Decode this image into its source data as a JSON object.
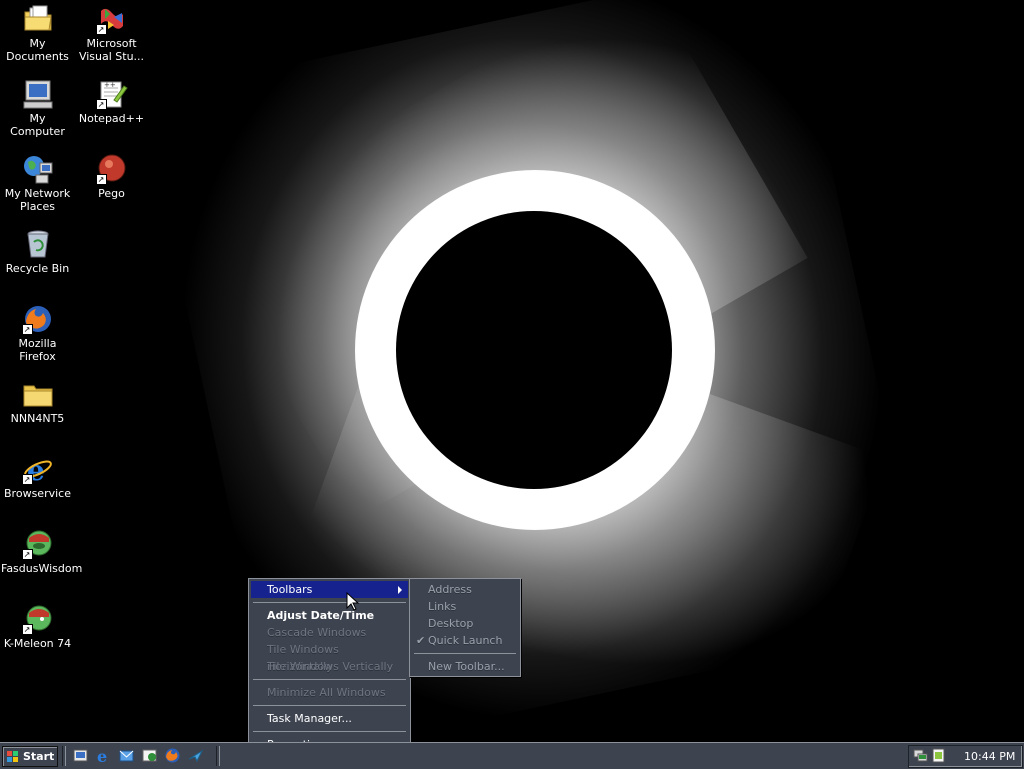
{
  "desktop": {
    "icons": [
      {
        "label": "My Documents",
        "icon": "folder-documents-icon"
      },
      {
        "label": "Microsoft Visual Stu...",
        "icon": "visual-studio-icon"
      },
      {
        "label": "My Computer",
        "icon": "computer-icon"
      },
      {
        "label": "Notepad++",
        "icon": "notepad-plus-plus-icon"
      },
      {
        "label": "My Network Places",
        "icon": "network-places-icon"
      },
      {
        "label": "Pego",
        "icon": "pego-icon"
      },
      {
        "label": "Recycle Bin",
        "icon": "recycle-bin-icon"
      },
      {
        "label": "Mozilla Firefox",
        "icon": "firefox-icon"
      },
      {
        "label": "NNN4NT5",
        "icon": "folder-icon"
      },
      {
        "label": "Browservice",
        "icon": "internet-explorer-icon"
      },
      {
        "label": "FasdusWisdom",
        "icon": "fasdus-wisdom-icon"
      },
      {
        "label": "K-Meleon 74",
        "icon": "k-meleon-icon"
      }
    ]
  },
  "context_menu": {
    "items": [
      {
        "label": "Toolbars",
        "state": "highlighted",
        "has_submenu": true
      },
      {
        "label": "Adjust Date/Time",
        "state": "bold"
      },
      {
        "label": "Cascade Windows",
        "state": "disabled"
      },
      {
        "label": "Tile Windows Horizontally",
        "state": "disabled"
      },
      {
        "label": "Tile Windows Vertically",
        "state": "disabled"
      },
      {
        "label": "Minimize All Windows",
        "state": "disabled"
      },
      {
        "label": "Task Manager...",
        "state": "normal"
      },
      {
        "label": "Properties",
        "state": "normal"
      }
    ]
  },
  "toolbars_submenu": {
    "items": [
      {
        "label": "Address",
        "checked": false
      },
      {
        "label": "Links",
        "checked": false
      },
      {
        "label": "Desktop",
        "checked": false
      },
      {
        "label": "Quick Launch",
        "checked": true
      },
      {
        "label": "New Toolbar...",
        "checked": false
      }
    ],
    "check_glyph": "✔"
  },
  "taskbar": {
    "start_label": "Start",
    "quick_launch": [
      "show-desktop-icon",
      "internet-explorer-icon",
      "outlook-express-icon",
      "mail-icon",
      "firefox-icon",
      "arrow-app-icon"
    ],
    "tray_icons": [
      "network-tray-icon",
      "notepad-tray-icon"
    ],
    "clock": "10:44 PM"
  },
  "colors": {
    "menu_bg": "#3d4450",
    "menu_highlight": "#16238f",
    "disabled_text": "#6e7480",
    "desktop_bg": "#000000"
  }
}
